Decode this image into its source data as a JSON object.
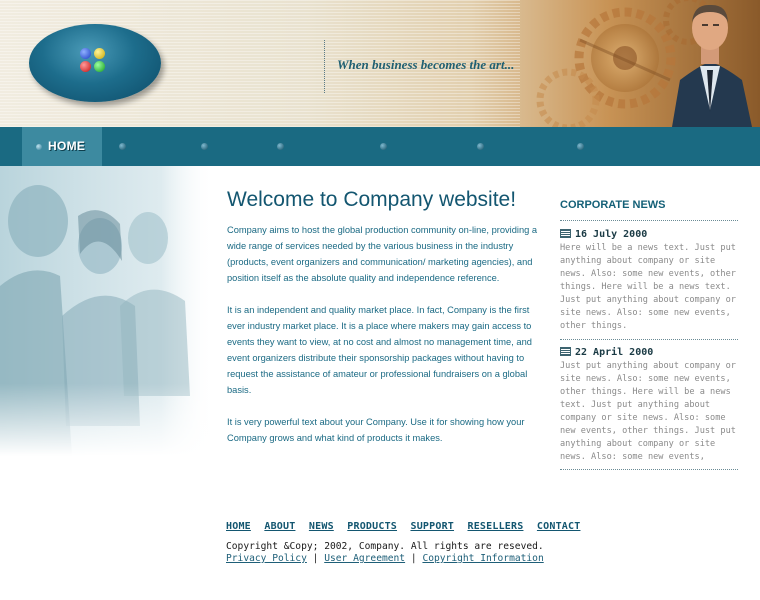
{
  "header": {
    "slogan": "When business becomes the art..."
  },
  "nav": {
    "home_label": "HOME",
    "dot_count": 6
  },
  "main": {
    "title": "Welcome to Company website!",
    "paragraphs": [
      "Company aims to host the global production community on-line, providing a wide range of services needed by the various business in the industry (products, event organizers and communication/ marketing agencies), and position itself as the absolute quality and independence reference.",
      "It is an independent and quality market place.  In fact, Company is the first ever industry market place. It is a place where makers may gain access to events they want to view, at no cost and almost no management time, and event organizers distribute their sponsorship packages without having to request the assistance of amateur or professional fundraisers on a global basis.",
      "It is very powerful text about your Company. Use it  for showing how your Company grows and what kind of products it makes."
    ]
  },
  "news": {
    "title": "CORPORATE NEWS",
    "items": [
      {
        "date": "16 July 2000",
        "text": "Here will be a news text. Just put anything about company or site news. Also: some new events, other things. Here will be a news text. Just put anything about company or site news. Also: some new events, other things."
      },
      {
        "date": "22 April 2000",
        "text": "Just put anything about company or site news. Also: some new events, other things. Here will be a news text. Just put anything about company or site news. Also: some new events, other things. Just put anything about company or site news. Also: some new events,"
      }
    ]
  },
  "footer": {
    "links": [
      "HOME",
      "ABOUT",
      "NEWS",
      "PRODUCTS",
      "SUPPORT",
      "RESELLERS",
      "CONTACT"
    ],
    "copyright": "Copyright &Copy; 2002, Company. All rights are reseved.",
    "privacy": "Privacy Policy",
    "agreement": "User Agreement",
    "copyright_info": "Copyright Information",
    "separator": "|"
  }
}
